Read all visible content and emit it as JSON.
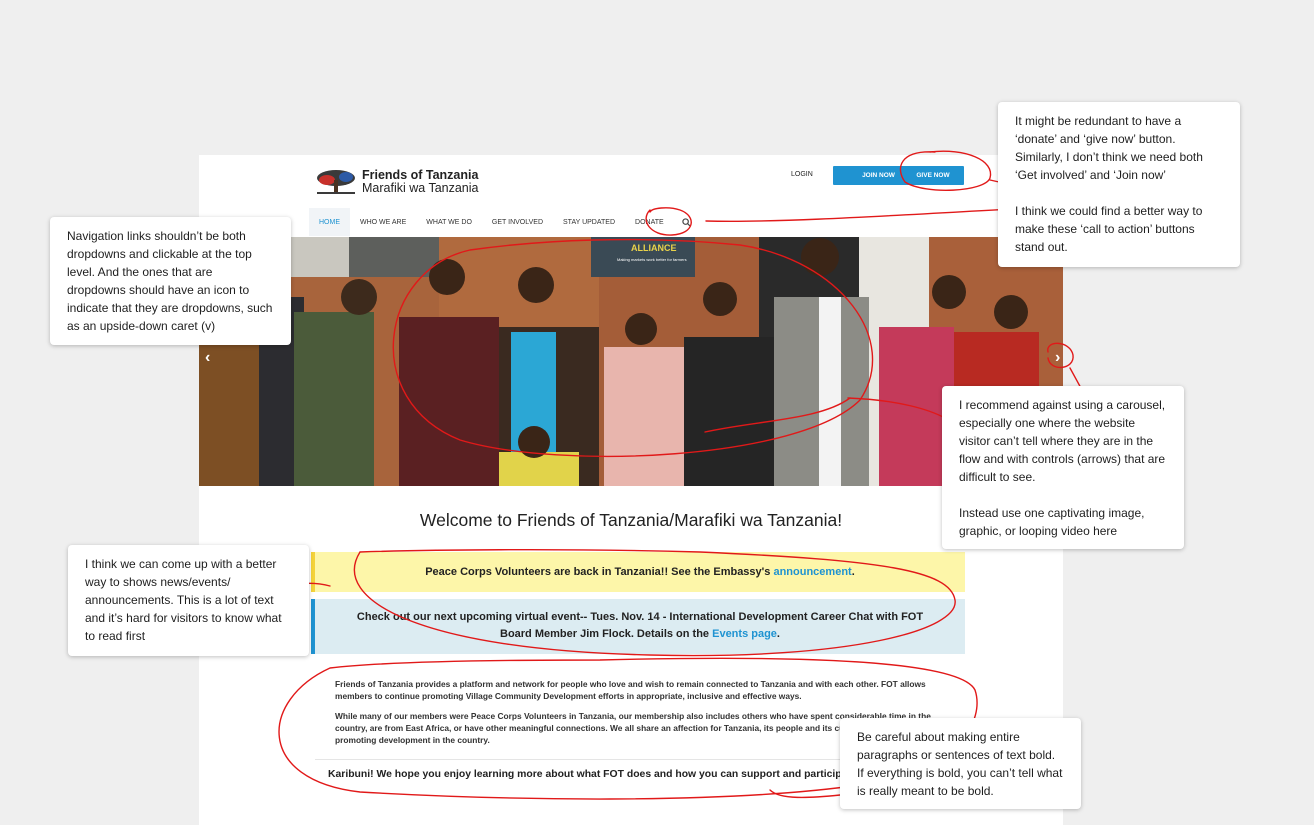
{
  "site": {
    "logo_title": "Friends of Tanzania",
    "logo_subtitle": "Marafiki wa Tanzania",
    "login_label": "LOGIN",
    "join_label": "JOIN NOW",
    "give_label": "GIVE NOW",
    "nav": [
      "HOME",
      "WHO WE ARE",
      "WHAT WE DO",
      "GET INVOLVED",
      "STAY UPDATED",
      "DONATE"
    ],
    "active_nav": "HOME",
    "hero_banner": "ALLIANCE",
    "hero_banner_sub": "Making markets work better for farmers",
    "welcome": "Welcome to Friends of Tanzania/Marafiki wa Tanzania!",
    "notice1_text": "Peace Corps Volunteers are back in Tanzania!! See the Embassy's ",
    "notice1_link": "announcement",
    "notice1_end": ".",
    "notice2_text": "Check out our next upcoming virtual event-- Tues. Nov. 14 - International Development Career Chat with FOT Board Member Jim Flock. Details on the ",
    "notice2_link": "Events page",
    "notice2_end": ".",
    "para1": "Friends of Tanzania provides a platform and network for people who love and wish to remain connected to Tanzania and with each other. FOT allows members to continue promoting Village Community Development efforts in appropriate, inclusive and effective ways.",
    "para2": "While many of our members were Peace Corps Volunteers in Tanzania, our membership also includes others who have spent considerable time in the country, are from East Africa, or have other meaningful connections. We all share an affection for Tanzania, its people and its culture, and a desire to continue promoting development in the country.",
    "para3": "Karibuni! We hope you enjoy learning more about what FOT does and how you can support and participate in our work."
  },
  "comments": {
    "c1": "It might be redundant to have a ‘donate’ and ‘give now’ button. Similarly, I don’t think we need both ‘Get involved’ and ‘Join now’\n\nI think we could find a better way to make these ‘call to action’ buttons stand out.",
    "c2": "Navigation links shouldn’t be both dropdowns and clickable at the top level. And the ones that are dropdowns should have an icon to indicate that they are dropdowns, such as an upside-down caret (v)",
    "c3": "I recommend against using a carousel, especially one where the website visitor can’t tell where they are in the flow and with controls (arrows) that are difficult to see.\n\nInstead use one captivating image, graphic, or looping video here",
    "c4": "I think we can come up with a better way to shows news/events/ announcements. This is a lot of text and it’s hard for visitors to know what to read first",
    "c5": "Be careful about making entire paragraphs or sentences of text bold. If everything is bold, you can’t tell what is really meant to be bold."
  },
  "colors": {
    "accent": "#1f93d1",
    "annotation": "#e11919",
    "notice_yellow": "#fdf6a9",
    "notice_blue": "#dcecf2"
  }
}
